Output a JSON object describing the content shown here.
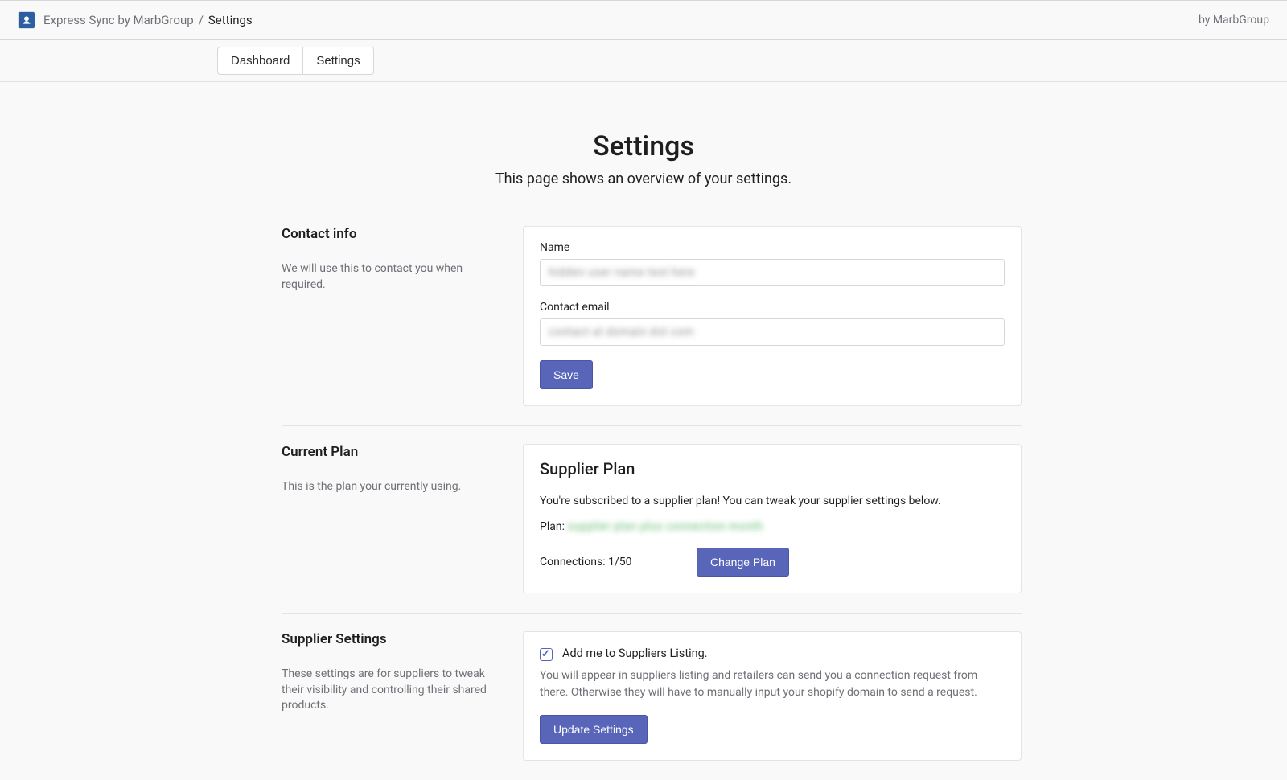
{
  "topbar": {
    "app_name": "Express Sync by MarbGroup",
    "separator": "/",
    "current": "Settings",
    "byline": "by MarbGroup"
  },
  "tabs": {
    "dashboard": "Dashboard",
    "settings": "Settings"
  },
  "header": {
    "title": "Settings",
    "subtitle": "This page shows an overview of your settings."
  },
  "contact": {
    "heading": "Contact info",
    "desc": "We will use this to contact you when required.",
    "name_label": "Name",
    "name_value": "hidden user name text here",
    "email_label": "Contact email",
    "email_value": "contact at domain dot com",
    "save_label": "Save"
  },
  "plan": {
    "heading": "Current Plan",
    "desc": "This is the plan your currently using.",
    "card_title": "Supplier Plan",
    "card_body": "You're subscribed to a supplier plan! You can tweak your supplier settings below.",
    "plan_label": "Plan:",
    "plan_value": "supplier plan plus connection month",
    "connections_label": "Connections: 1/50",
    "change_label": "Change Plan"
  },
  "supplier": {
    "heading": "Supplier Settings",
    "desc": "These settings are for suppliers to tweak their visibility and controlling their shared products.",
    "check_label": "Add me to Suppliers Listing.",
    "help_text": "You will appear in suppliers listing and retailers can send you a connection request from there. Otherwise they will have to manually input your shopify domain to send a request.",
    "update_label": "Update Settings"
  }
}
